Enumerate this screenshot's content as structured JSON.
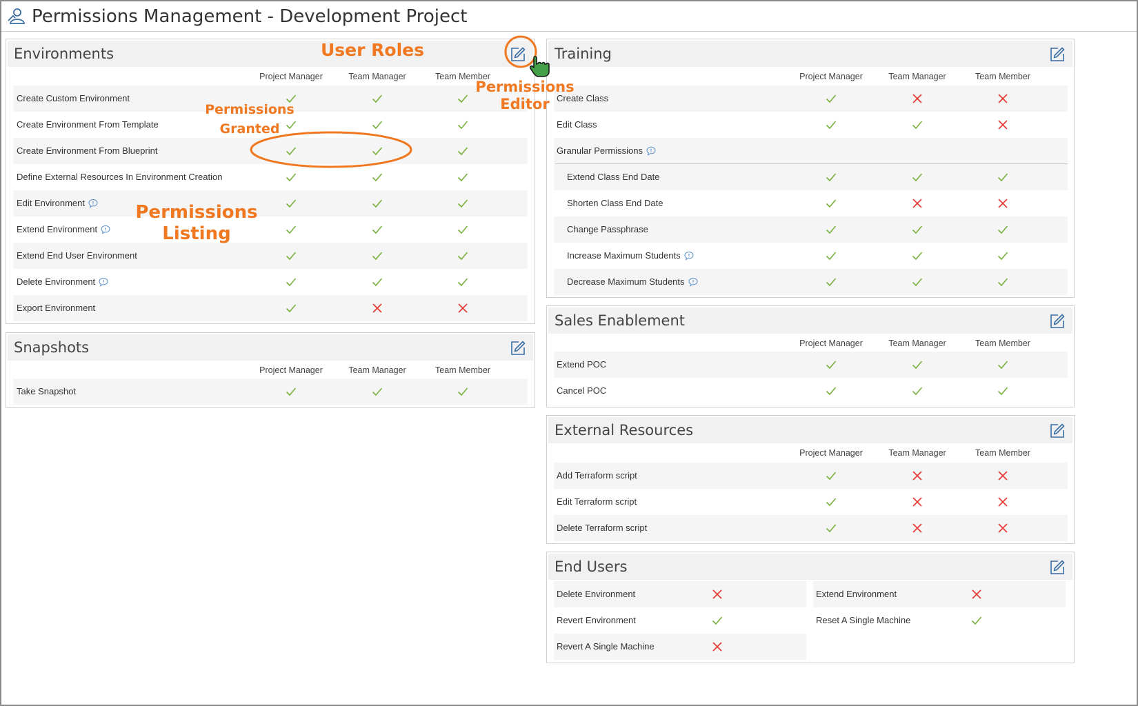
{
  "page": {
    "title": "Permissions Management - Development Project",
    "accent_color": "#f07820",
    "check_color": "#7cb342",
    "cross_color": "#e53935"
  },
  "annotations": {
    "user_roles": "User Roles",
    "permissions_editor_line1": "Permissions",
    "permissions_editor_line2": "Editor",
    "permissions_granted_line1": "Permissions",
    "permissions_granted_line2": "Granted",
    "permissions_listing_line1": "Permissions",
    "permissions_listing_line2": "Listing"
  },
  "roles": [
    "Project Manager",
    "Team Manager",
    "Team Member"
  ],
  "panels": {
    "environments": {
      "title": "Environments",
      "rows": [
        {
          "label": "Create Custom Environment",
          "info": false,
          "perms": [
            true,
            true,
            true
          ]
        },
        {
          "label": "Create Environment From Template",
          "info": false,
          "perms": [
            true,
            true,
            true
          ]
        },
        {
          "label": "Create Environment From Blueprint",
          "info": false,
          "perms": [
            true,
            true,
            true
          ]
        },
        {
          "label": "Define External Resources In Environment Creation",
          "info": false,
          "perms": [
            true,
            true,
            true
          ]
        },
        {
          "label": "Edit Environment",
          "info": true,
          "perms": [
            true,
            true,
            true
          ]
        },
        {
          "label": "Extend Environment",
          "info": true,
          "perms": [
            true,
            true,
            true
          ]
        },
        {
          "label": "Extend End User Environment",
          "info": false,
          "perms": [
            true,
            true,
            true
          ]
        },
        {
          "label": "Delete Environment",
          "info": true,
          "perms": [
            true,
            true,
            true
          ]
        },
        {
          "label": "Export Environment",
          "info": false,
          "perms": [
            true,
            false,
            false
          ]
        }
      ]
    },
    "snapshots": {
      "title": "Snapshots",
      "rows": [
        {
          "label": "Take Snapshot",
          "info": false,
          "perms": [
            true,
            true,
            true
          ]
        }
      ]
    },
    "training": {
      "title": "Training",
      "rows": [
        {
          "label": "Create Class",
          "info": false,
          "perms": [
            true,
            false,
            false
          ]
        },
        {
          "label": "Edit Class",
          "info": false,
          "perms": [
            true,
            true,
            false
          ]
        }
      ],
      "group_label": "Granular Permissions",
      "group_rows": [
        {
          "label": "Extend Class End Date",
          "info": false,
          "perms": [
            true,
            true,
            true
          ]
        },
        {
          "label": "Shorten Class End Date",
          "info": false,
          "perms": [
            true,
            false,
            false
          ]
        },
        {
          "label": "Change Passphrase",
          "info": false,
          "perms": [
            true,
            true,
            true
          ]
        },
        {
          "label": "Increase Maximum Students",
          "info": true,
          "perms": [
            true,
            true,
            true
          ]
        },
        {
          "label": "Decrease Maximum Students",
          "info": true,
          "perms": [
            true,
            true,
            true
          ]
        }
      ]
    },
    "sales_enablement": {
      "title": "Sales Enablement",
      "rows": [
        {
          "label": "Extend POC",
          "info": false,
          "perms": [
            true,
            true,
            true
          ]
        },
        {
          "label": "Cancel POC",
          "info": false,
          "perms": [
            true,
            true,
            true
          ]
        }
      ]
    },
    "external_resources": {
      "title": "External Resources",
      "rows": [
        {
          "label": "Add Terraform script",
          "info": false,
          "perms": [
            true,
            false,
            false
          ]
        },
        {
          "label": "Edit Terraform script",
          "info": false,
          "perms": [
            true,
            false,
            false
          ]
        },
        {
          "label": "Delete Terraform script",
          "info": false,
          "perms": [
            true,
            false,
            false
          ]
        }
      ]
    },
    "end_users": {
      "title": "End Users",
      "items": [
        {
          "label": "Delete Environment",
          "granted": false
        },
        {
          "label": "Extend Environment",
          "granted": false
        },
        {
          "label": "Revert Environment",
          "granted": true
        },
        {
          "label": "Reset A Single Machine",
          "granted": true
        },
        {
          "label": "Revert A Single Machine",
          "granted": false
        }
      ]
    }
  }
}
